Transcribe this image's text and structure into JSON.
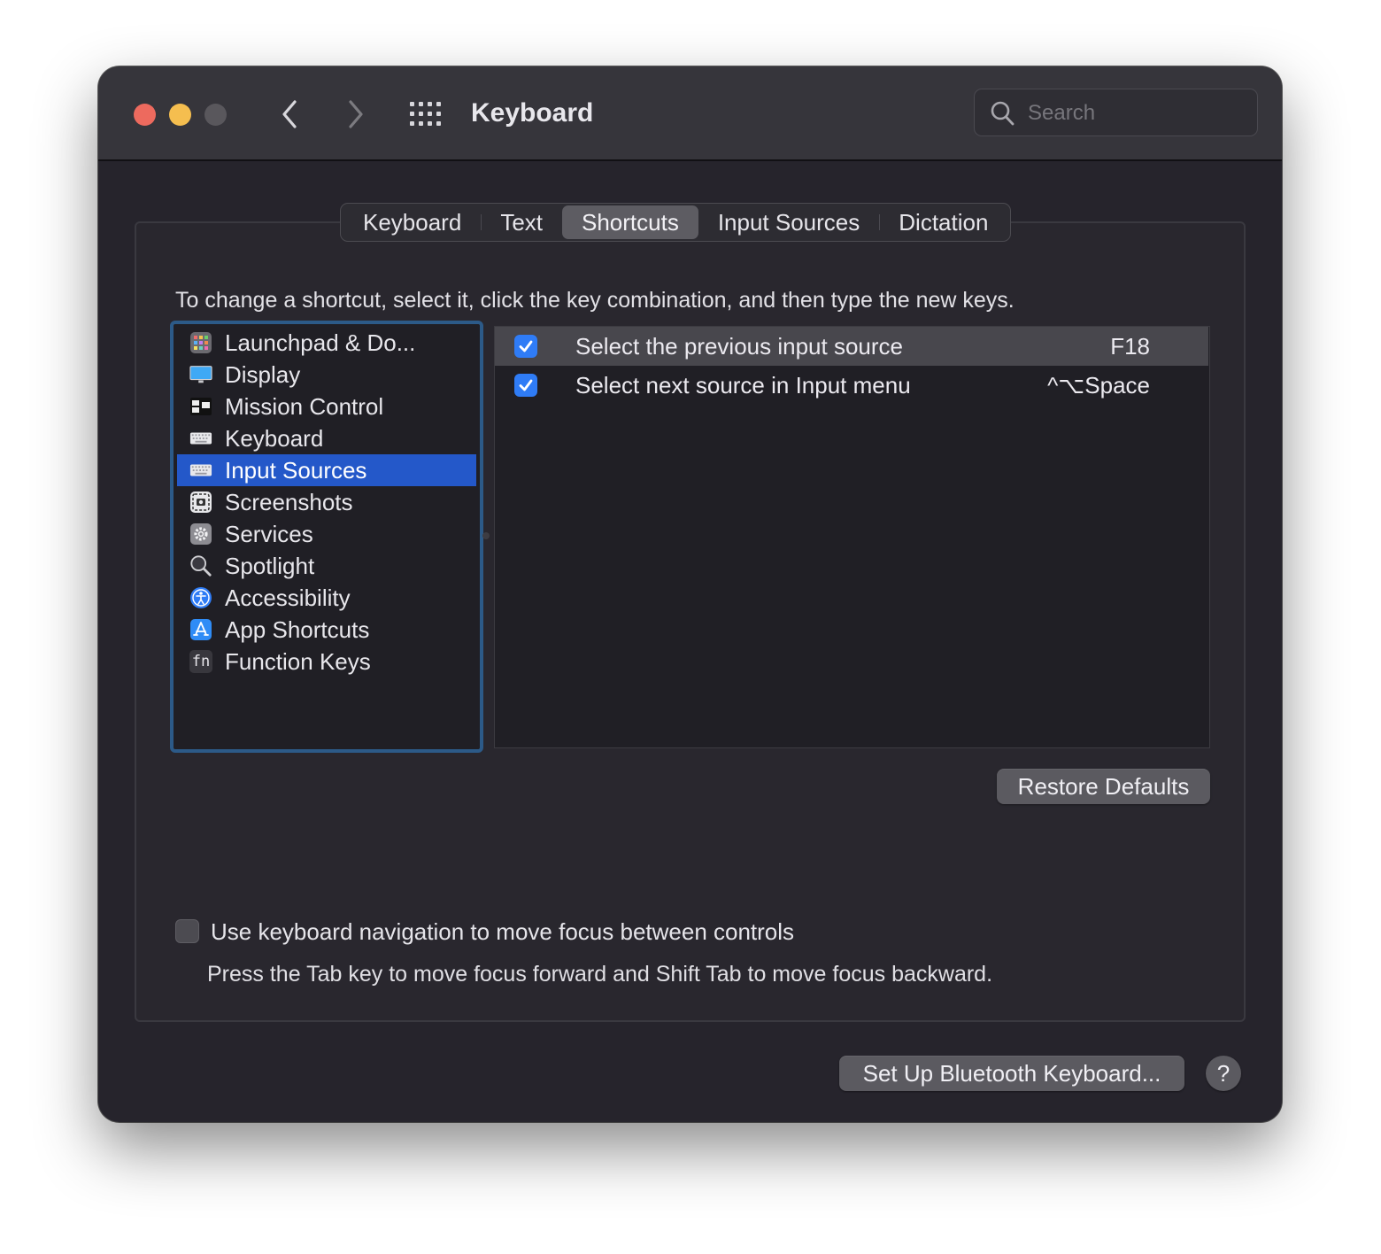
{
  "window": {
    "title": "Keyboard",
    "search_placeholder": "Search"
  },
  "tabs": [
    {
      "label": "Keyboard"
    },
    {
      "label": "Text"
    },
    {
      "label": "Shortcuts",
      "active": true
    },
    {
      "label": "Input Sources"
    },
    {
      "label": "Dictation"
    }
  ],
  "hint": "To change a shortcut, select it, click the key combination, and then type the new keys.",
  "categories": [
    {
      "label": "Launchpad & Do...",
      "icon": "launchpad-icon"
    },
    {
      "label": "Display",
      "icon": "display-icon"
    },
    {
      "label": "Mission Control",
      "icon": "mission-control-icon"
    },
    {
      "label": "Keyboard",
      "icon": "keyboard-icon"
    },
    {
      "label": "Input Sources",
      "icon": "keyboard-icon",
      "selected": true
    },
    {
      "label": "Screenshots",
      "icon": "screenshot-icon"
    },
    {
      "label": "Services",
      "icon": "gear-icon"
    },
    {
      "label": "Spotlight",
      "icon": "magnifier-icon"
    },
    {
      "label": "Accessibility",
      "icon": "accessibility-icon"
    },
    {
      "label": "App Shortcuts",
      "icon": "app-store-icon"
    },
    {
      "label": "Function Keys",
      "icon": "fn-icon",
      "glyph": "fn"
    }
  ],
  "shortcuts": [
    {
      "label": "Select the previous input source",
      "key": "F18",
      "checked": true,
      "highlighted": true
    },
    {
      "label": "Select next source in Input menu",
      "key": "^⌥Space",
      "checked": true
    }
  ],
  "buttons": {
    "restore_defaults": "Restore Defaults",
    "bluetooth": "Set Up Bluetooth Keyboard...",
    "help": "?"
  },
  "keyboard_navigation": {
    "label": "Use keyboard navigation to move focus between controls",
    "checked": false,
    "description": "Press the Tab key to move focus forward and Shift Tab to move focus backward."
  },
  "colors": {
    "accent": "#2f7cf6",
    "selection": "#2458c9",
    "window_bg": "#26242c"
  }
}
